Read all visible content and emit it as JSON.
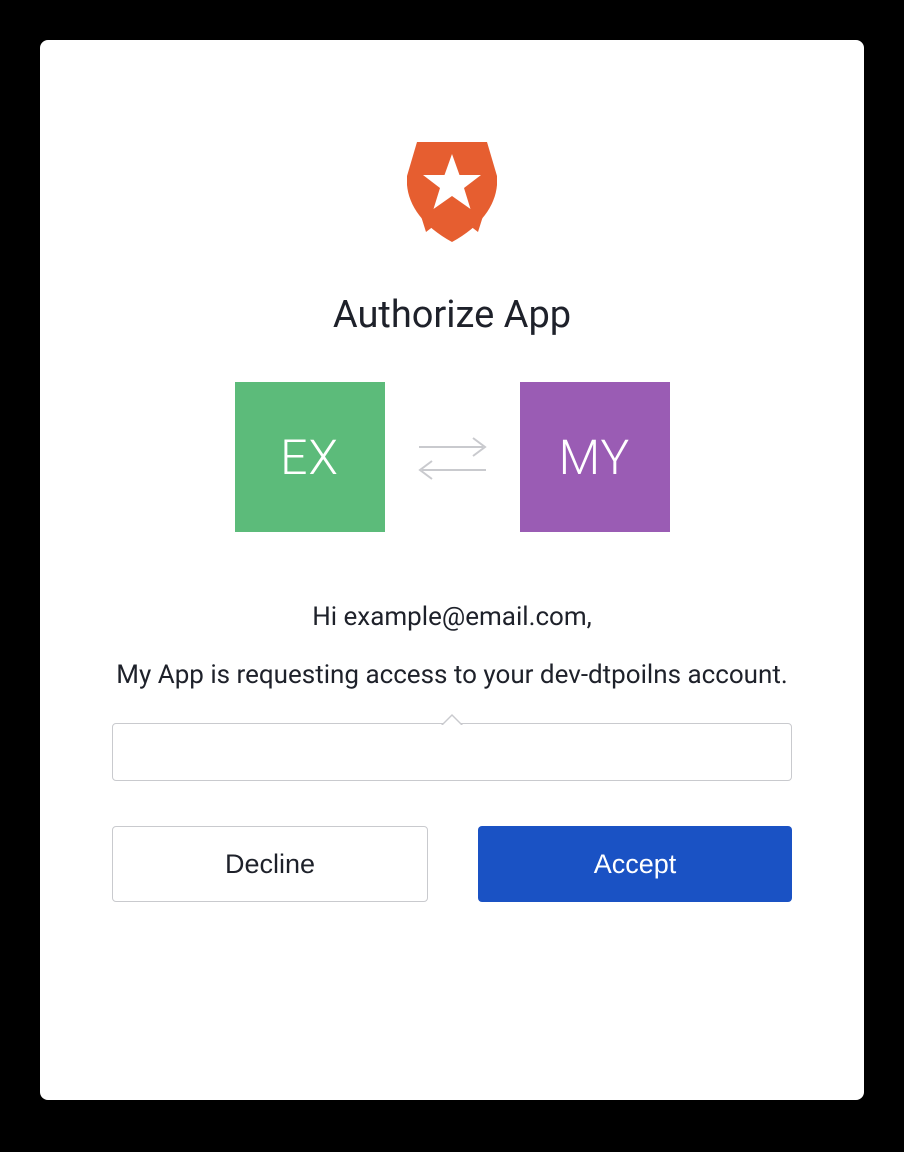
{
  "title": "Authorize App",
  "apps": {
    "left_label": "EX",
    "right_label": "MY",
    "left_color": "#5cbb7a",
    "right_color": "#9a5cb4"
  },
  "greeting": "Hi example@email.com,",
  "description": "My App is requesting access to your dev-dtpoilns account.",
  "buttons": {
    "decline_label": "Decline",
    "accept_label": "Accept"
  },
  "icons": {
    "logo": "auth0-shield-icon",
    "exchange": "exchange-arrows-icon"
  }
}
